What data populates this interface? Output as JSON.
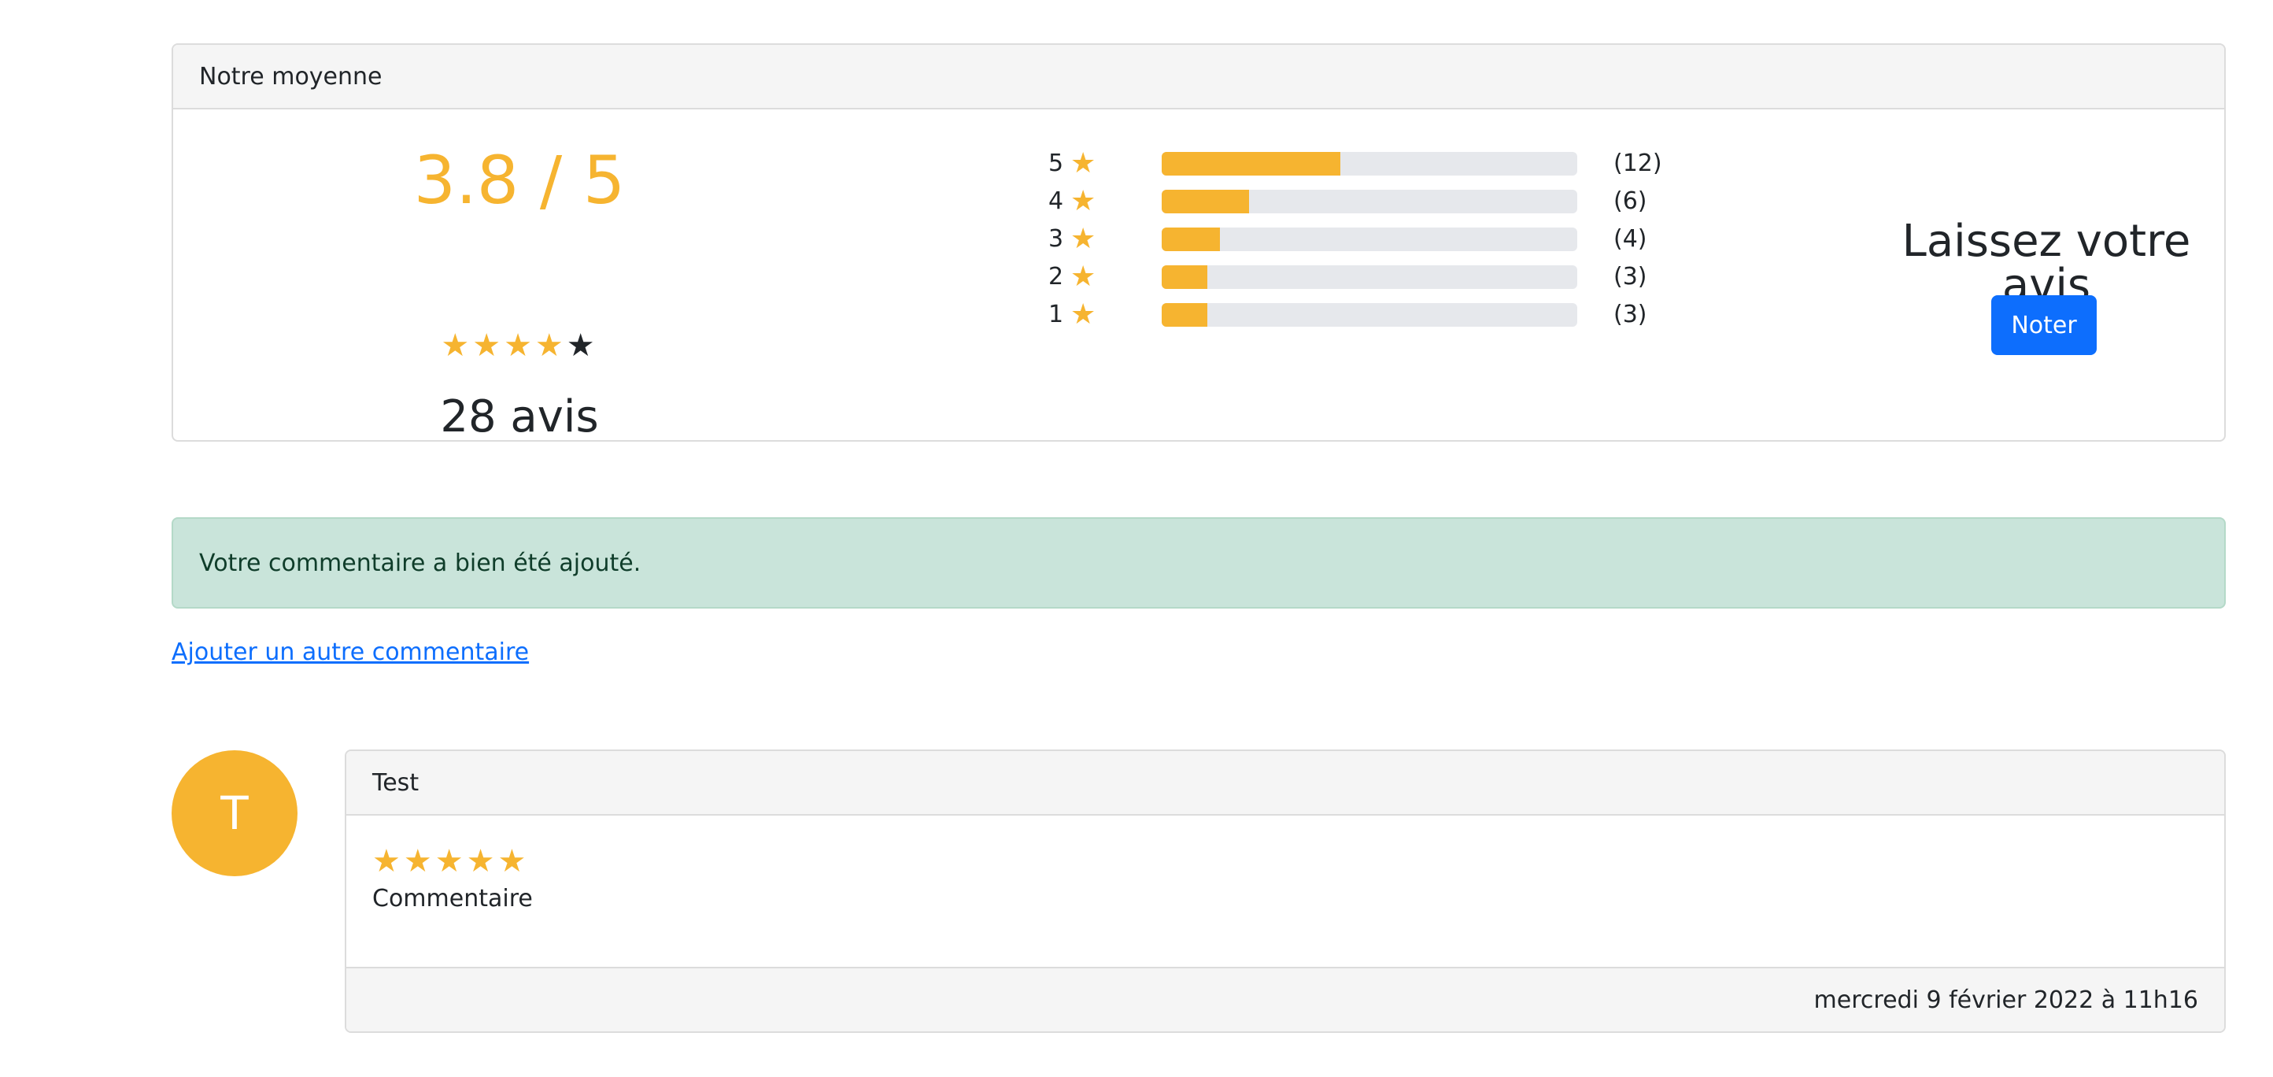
{
  "summary": {
    "header": "Notre moyenne",
    "average_text": "3.8 / 5",
    "average_value": 3.8,
    "stars_filled": 4,
    "stars_total": 5,
    "reviews_text": "28 avis",
    "distribution": [
      {
        "label": "5",
        "count": 12,
        "count_text": "(12)",
        "fill_fraction": 0.43
      },
      {
        "label": "4",
        "count": 6,
        "count_text": "(6)",
        "fill_fraction": 0.21
      },
      {
        "label": "3",
        "count": 4,
        "count_text": "(4)",
        "fill_fraction": 0.14
      },
      {
        "label": "2",
        "count": 3,
        "count_text": "(3)",
        "fill_fraction": 0.11
      },
      {
        "label": "1",
        "count": 3,
        "count_text": "(3)",
        "fill_fraction": 0.11
      }
    ],
    "cta_title": "Laissez votre avis",
    "cta_button": "Noter"
  },
  "alert": {
    "text": "Votre commentaire a bien été ajouté."
  },
  "add_link": "Ajouter un autre commentaire",
  "comment": {
    "avatar_letter": "T",
    "author": "Test",
    "stars": 5,
    "text": "Commentaire",
    "date": "mercredi 9 février 2022 à 11h16"
  },
  "colors": {
    "accent": "#f6b430",
    "primary": "#0d6efd",
    "alert_bg": "#c9e4da"
  },
  "icons": {
    "star": "star-icon"
  }
}
